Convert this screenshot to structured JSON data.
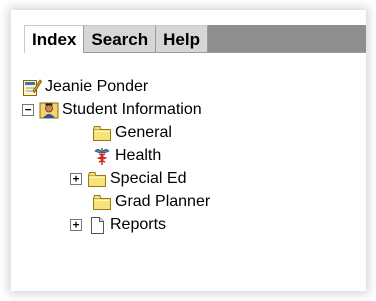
{
  "tabs": [
    {
      "label": "Index",
      "active": true
    },
    {
      "label": "Search",
      "active": false
    },
    {
      "label": "Help",
      "active": false
    }
  ],
  "tree": {
    "user": {
      "label": "Jeanie Ponder",
      "icon": "edit-user-icon"
    },
    "student_information": {
      "label": "Student Information",
      "expanded": true,
      "toggle": "−",
      "icon": "student-icon"
    },
    "general": {
      "label": "General",
      "icon": "folder-icon"
    },
    "health": {
      "label": "Health",
      "icon": "caduceus-icon"
    },
    "special_ed": {
      "label": "Special Ed",
      "expanded": false,
      "toggle": "+",
      "icon": "folder-icon"
    },
    "grad_planner": {
      "label": "Grad Planner",
      "icon": "folder-icon"
    },
    "reports": {
      "label": "Reports",
      "expanded": false,
      "toggle": "+",
      "icon": "document-icon"
    }
  },
  "colors": {
    "folder": "#f5e27a",
    "folder_outline": "#9a7a10",
    "tab_inactive": "#d6d6d6",
    "tab_fill": "#8f8f8f"
  }
}
